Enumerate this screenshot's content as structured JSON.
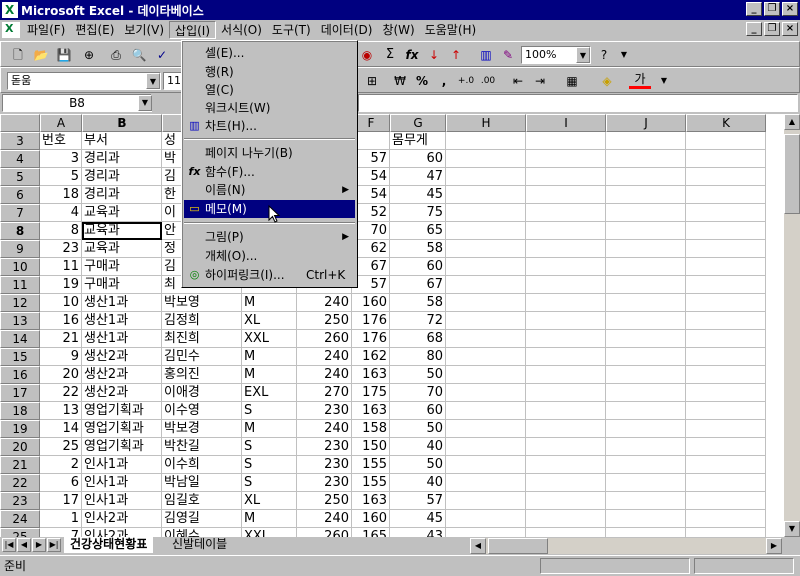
{
  "window": {
    "title": "Microsoft Excel - 데이타베이스",
    "app_icon_letter": "X",
    "controls": {
      "minimize": "_",
      "restore": "❐",
      "close": "×"
    }
  },
  "menubar": {
    "items": [
      "파일(F)",
      "편집(E)",
      "보기(V)",
      "삽입(I)",
      "서식(O)",
      "도구(T)",
      "데이터(D)",
      "창(W)",
      "도움말(H)"
    ],
    "active_index": 3
  },
  "toolbar": {
    "zoom": "100%",
    "font_name": "돋움",
    "font_size": "11",
    "sigma": "Σ",
    "fx": "fx",
    "comma": ",",
    "percent": "%",
    "won": "₩",
    "font_color_char": "가"
  },
  "formula_bar": {
    "name_box": "B8"
  },
  "insert_menu": {
    "items": [
      {
        "label": "셀(E)...",
        "icon": ""
      },
      {
        "label": "행(R)",
        "icon": ""
      },
      {
        "label": "열(C)",
        "icon": ""
      },
      {
        "label": "워크시트(W)",
        "icon": ""
      },
      {
        "label": "차트(H)...",
        "icon": "chart-icon"
      },
      {
        "label": "페이지 나누기(B)",
        "icon": ""
      },
      {
        "label": "함수(F)...",
        "icon": "function-icon"
      },
      {
        "label": "이름(N)",
        "icon": "",
        "submenu": true
      },
      {
        "label": "메모(M)",
        "icon": "comment-icon",
        "highlighted": true
      },
      {
        "label": "그림(P)",
        "icon": "",
        "submenu": true
      },
      {
        "label": "개체(O)...",
        "icon": ""
      },
      {
        "label": "하이퍼링크(I)...",
        "icon": "hyperlink-icon",
        "shortcut": "Ctrl+K"
      }
    ]
  },
  "grid": {
    "columns": [
      "A",
      "B",
      "C",
      "D",
      "E",
      "F",
      "G",
      "H",
      "I",
      "J",
      "K"
    ],
    "header_row": {
      "row": "3",
      "cells": [
        "번호",
        "부서",
        "성",
        "",
        "",
        "l",
        "몸무게"
      ]
    },
    "rows": [
      {
        "row": "4",
        "cells": [
          "3",
          "경리과",
          "박",
          "",
          "",
          "57",
          "60"
        ]
      },
      {
        "row": "5",
        "cells": [
          "5",
          "경리과",
          "김",
          "",
          "",
          "54",
          "47"
        ]
      },
      {
        "row": "6",
        "cells": [
          "18",
          "경리과",
          "한",
          "",
          "",
          "54",
          "45"
        ]
      },
      {
        "row": "7",
        "cells": [
          "4",
          "교육과",
          "이",
          "",
          "",
          "52",
          "75"
        ]
      },
      {
        "row": "8",
        "cells": [
          "8",
          "교육과",
          "안",
          "",
          "",
          "70",
          "65"
        ]
      },
      {
        "row": "9",
        "cells": [
          "23",
          "교육과",
          "정",
          "",
          "",
          "62",
          "58"
        ]
      },
      {
        "row": "10",
        "cells": [
          "11",
          "구매과",
          "김",
          "",
          "",
          "67",
          "60"
        ]
      },
      {
        "row": "11",
        "cells": [
          "19",
          "구매과",
          "최",
          "",
          "",
          "57",
          "67"
        ]
      },
      {
        "row": "12",
        "cells": [
          "10",
          "생산1과",
          "박보영",
          "M",
          "240",
          "160",
          "58"
        ]
      },
      {
        "row": "13",
        "cells": [
          "16",
          "생산1과",
          "김정희",
          "XL",
          "250",
          "176",
          "72"
        ]
      },
      {
        "row": "14",
        "cells": [
          "21",
          "생산1과",
          "최진희",
          "XXL",
          "260",
          "176",
          "68"
        ]
      },
      {
        "row": "15",
        "cells": [
          "9",
          "생산2과",
          "김민수",
          "M",
          "240",
          "162",
          "80"
        ]
      },
      {
        "row": "16",
        "cells": [
          "20",
          "생산2과",
          "홍의진",
          "M",
          "240",
          "163",
          "50"
        ]
      },
      {
        "row": "17",
        "cells": [
          "22",
          "생산2과",
          "이애경",
          "EXL",
          "270",
          "175",
          "70"
        ]
      },
      {
        "row": "18",
        "cells": [
          "13",
          "영업기획과",
          "이수영",
          "S",
          "230",
          "163",
          "60"
        ]
      },
      {
        "row": "19",
        "cells": [
          "14",
          "영업기획과",
          "박보경",
          "M",
          "240",
          "158",
          "50"
        ]
      },
      {
        "row": "20",
        "cells": [
          "25",
          "영업기획과",
          "박찬길",
          "S",
          "230",
          "150",
          "40"
        ]
      },
      {
        "row": "21",
        "cells": [
          "2",
          "인사1과",
          "이수희",
          "S",
          "230",
          "155",
          "50"
        ]
      },
      {
        "row": "22",
        "cells": [
          "6",
          "인사1과",
          "박남일",
          "S",
          "230",
          "155",
          "40"
        ]
      },
      {
        "row": "23",
        "cells": [
          "17",
          "인사1과",
          "임길호",
          "XL",
          "250",
          "163",
          "57"
        ]
      },
      {
        "row": "24",
        "cells": [
          "1",
          "인사2과",
          "김영길",
          "M",
          "240",
          "160",
          "45"
        ]
      },
      {
        "row": "25",
        "cells": [
          "7",
          "인사2과",
          "이혜수",
          "XXL",
          "260",
          "165",
          "43"
        ]
      }
    ],
    "active_row": "8"
  },
  "sheet_tabs": [
    "건강상태현황표",
    "신발테이블"
  ],
  "status": {
    "text": "준비"
  }
}
